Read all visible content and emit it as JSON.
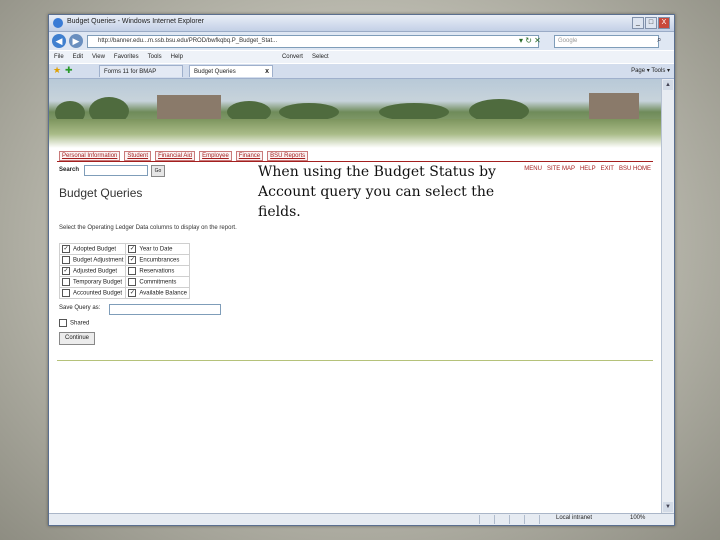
{
  "window": {
    "title": "Budget Queries - Windows Internet Explorer",
    "controls": [
      "_",
      "□",
      "X"
    ]
  },
  "address_bar": {
    "url": "http://banner.edu...m.ssb.bsu.edu/PROD/bwfkqbq.P_Budget_Stat...",
    "search_placeholder": "Google"
  },
  "menu": [
    "File",
    "Edit",
    "View",
    "Favorites",
    "Tools",
    "Help"
  ],
  "menu_extras": [
    "Convert",
    "Select"
  ],
  "tabs": [
    {
      "label": "Forms 11 for BMAP"
    },
    {
      "label": "Budget Queries",
      "close": "x"
    }
  ],
  "ie_tools": "Page ▾   Tools ▾",
  "page": {
    "nav_tabs": [
      "Personal Information",
      "Student",
      "Financial Aid",
      "Employee",
      "Finance",
      "BSU Reports"
    ],
    "search_label": "Search",
    "go_label": "Go",
    "top_links": [
      "MENU",
      "SITE MAP",
      "HELP",
      "EXIT",
      "BSU HOME"
    ],
    "title": "Budget Queries",
    "instruction": "Select the Operating Ledger Data columns to display on the report.",
    "options": [
      [
        {
          "label": "Adopted Budget",
          "checked": true
        },
        {
          "label": "Year to Date",
          "checked": true
        }
      ],
      [
        {
          "label": "Budget Adjustment",
          "checked": false
        },
        {
          "label": "Encumbrances",
          "checked": true
        }
      ],
      [
        {
          "label": "Adjusted Budget",
          "checked": true
        },
        {
          "label": "Reservations",
          "checked": false
        }
      ],
      [
        {
          "label": "Temporary Budget",
          "checked": false
        },
        {
          "label": "Commitments",
          "checked": false
        }
      ],
      [
        {
          "label": "Accounted Budget",
          "checked": false
        },
        {
          "label": "Available Balance",
          "checked": true
        }
      ]
    ],
    "save_query_label": "Save Query as:",
    "shared_label": "Shared",
    "continue_label": "Continue"
  },
  "overlay_text": "When using the Budget Status by Account query you can select the fields.",
  "status_bar": {
    "zone": "Local intranet",
    "zoom": "100%"
  }
}
